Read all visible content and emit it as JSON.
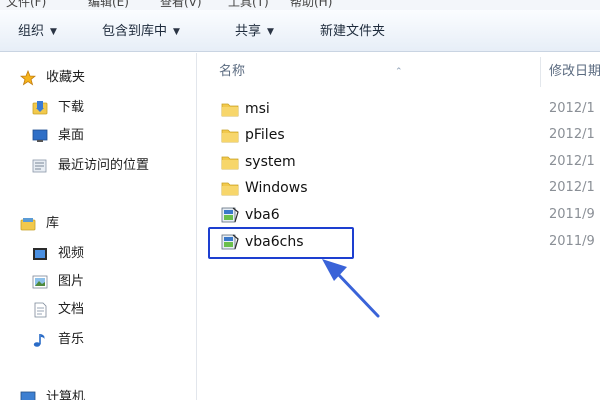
{
  "menubar": {
    "items": [
      "文件(F)",
      "编辑(E)",
      "查看(V)",
      "工具(T)",
      "帮助(H)"
    ]
  },
  "toolbar": {
    "buttons": [
      {
        "label": "组织",
        "dropdown": true
      },
      {
        "label": "包含到库中",
        "dropdown": true
      },
      {
        "label": "共享",
        "dropdown": true
      },
      {
        "label": "新建文件夹",
        "dropdown": false
      }
    ]
  },
  "sidebar": {
    "favorites": {
      "label": "收藏夹",
      "icon": "star-icon",
      "items": [
        {
          "label": "下载",
          "icon": "download-folder-icon"
        },
        {
          "label": "桌面",
          "icon": "desktop-icon"
        },
        {
          "label": "最近访问的位置",
          "icon": "recent-places-icon"
        }
      ]
    },
    "libraries": {
      "label": "库",
      "icon": "library-icon",
      "items": [
        {
          "label": "视频",
          "icon": "video-icon"
        },
        {
          "label": "图片",
          "icon": "picture-icon"
        },
        {
          "label": "文档",
          "icon": "document-icon"
        },
        {
          "label": "音乐",
          "icon": "music-icon"
        }
      ]
    },
    "computer": {
      "label": "计算机",
      "icon": "computer-icon"
    }
  },
  "filelist": {
    "columns": {
      "name": "名称",
      "modified": "修改日期"
    },
    "rows": [
      {
        "name": "msi",
        "type": "folder",
        "date": "2012/1"
      },
      {
        "name": "pFiles",
        "type": "folder",
        "date": "2012/1"
      },
      {
        "name": "system",
        "type": "folder",
        "date": "2012/1"
      },
      {
        "name": "Windows",
        "type": "folder",
        "date": "2012/1"
      },
      {
        "name": "vba6",
        "type": "installer",
        "date": "2011/9"
      },
      {
        "name": "vba6chs",
        "type": "installer",
        "date": "2011/9"
      }
    ]
  },
  "colors": {
    "highlight": "#1d3fd0",
    "arrow": "#3a63d8",
    "folder": "#f2c94c"
  }
}
